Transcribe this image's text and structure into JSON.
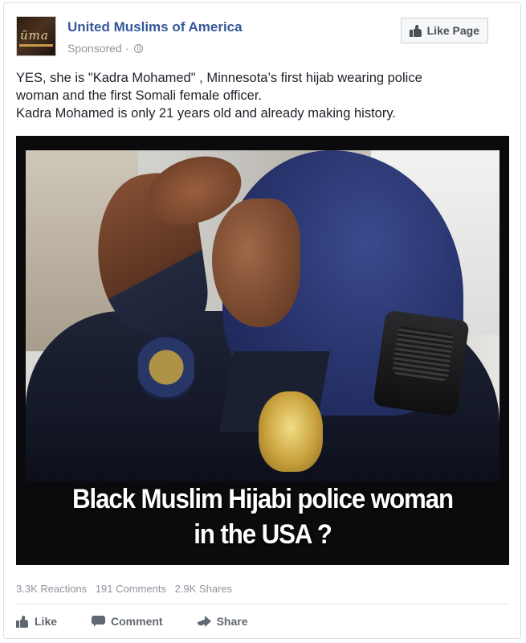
{
  "page": {
    "name": "United Muslims of America",
    "sponsored_label": "Sponsored",
    "sponsored_sep": " · ",
    "avatar_text": "ūma",
    "like_page_label": "Like Page"
  },
  "post": {
    "lines": [
      "YES, she is \"Kadra Mohamed\" , Minnesota’s first hijab wearing police",
      "woman and the first Somali female officer.",
      "Kadra Mohamed is only 21 years old and already making history."
    ],
    "image_caption_line1": "Black Muslim Hijabi police woman",
    "image_caption_line2": "in the USA ?"
  },
  "stats": {
    "reactions": "3.3K Reactions",
    "comments": "191 Comments",
    "shares": "2.9K Shares"
  },
  "actions": {
    "like": "Like",
    "comment": "Comment",
    "share": "Share"
  },
  "icons": {
    "globe": "globe-icon",
    "like": "thumbs-up-icon",
    "comment": "comment-bubble-icon",
    "share": "share-arrow-icon"
  },
  "colors": {
    "link": "#365899",
    "meta": "#90949c",
    "text": "#1d2129",
    "action": "#616770"
  }
}
